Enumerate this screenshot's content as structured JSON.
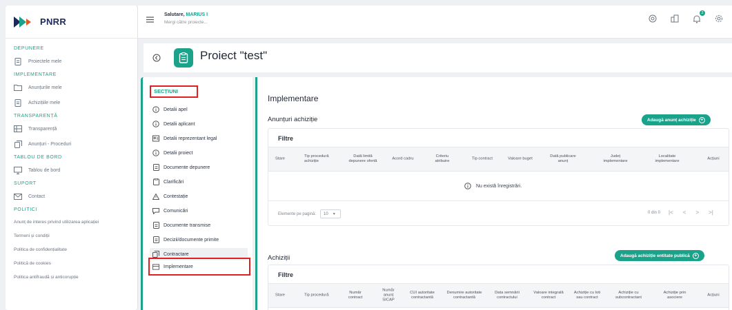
{
  "logo": {
    "text": "PNRR"
  },
  "sidebar": {
    "sections": [
      {
        "title": "DEPUNERE",
        "items": [
          {
            "label": "Proiectele mele",
            "icon": "document-icon"
          }
        ]
      },
      {
        "title": "IMPLEMENTARE",
        "items": [
          {
            "label": "Anunțurile mele",
            "icon": "folder-icon"
          },
          {
            "label": "Achizițiile mele",
            "icon": "document-icon"
          }
        ]
      },
      {
        "title": "TRANSPARENȚĂ",
        "items": [
          {
            "label": "Transparență",
            "icon": "grid-icon"
          },
          {
            "label": "Anunțuri - Proceduri",
            "icon": "copy-icon"
          }
        ]
      },
      {
        "title": "TABLOU DE BORD",
        "items": [
          {
            "label": "Tablou de bord",
            "icon": "monitor-icon"
          }
        ]
      },
      {
        "title": "SUPORT",
        "items": [
          {
            "label": "Contact",
            "icon": "mail-icon"
          }
        ]
      },
      {
        "title": "POLITICI",
        "items": []
      }
    ],
    "policy_links": [
      "Anunț de interes privind utilizarea aplicației",
      "Termeni și condiții",
      "Politica de confidențialitate",
      "Politică de cookies",
      "Politica antifraudă și anticorupție"
    ]
  },
  "header": {
    "greeting": "Salutare,",
    "user_name": "MARIUS I",
    "goto": "Mergi către proiecte...",
    "badge_count": "2"
  },
  "project": {
    "title": "Proiect \"test\""
  },
  "sections_panel": {
    "title": "SECȚIUNI",
    "items": [
      {
        "label": "Detalii apel",
        "icon": "info-icon"
      },
      {
        "label": "Detalii aplicant",
        "icon": "info-icon"
      },
      {
        "label": "Detalii reprezentant legal",
        "icon": "id-card-icon"
      },
      {
        "label": "Detalii proiect",
        "icon": "info-icon"
      },
      {
        "label": "Documente depunere",
        "icon": "document-icon"
      },
      {
        "label": "Clarificări",
        "icon": "clipboard-icon"
      },
      {
        "label": "Contestație",
        "icon": "warning-icon"
      },
      {
        "label": "Comunicări",
        "icon": "chat-icon"
      },
      {
        "label": "Documente transmise",
        "icon": "document-icon"
      },
      {
        "label": "Decizii/documente primite",
        "icon": "document-icon"
      },
      {
        "label": "Contractare",
        "icon": "copy-icon"
      },
      {
        "label": "Implementare",
        "icon": "table-icon"
      }
    ],
    "active_index": 11
  },
  "main": {
    "title": "Implementare",
    "anunturi": {
      "title": "Anunțuri achiziție",
      "add_button": "Adaugă anunț achiziție",
      "filter_label": "Filtre",
      "columns": [
        "Stare",
        "Tip procedură achiziție",
        "Dată limită depunere ofertă",
        "Acord cadru",
        "Criteriu atribuire",
        "Tip contract",
        "Valoare buget",
        "Dată publicare anunț",
        "Județ implementare",
        "Localitate implementare",
        "Acțiuni"
      ],
      "empty_text": "Nu există înregistrări.",
      "per_page_label": "Elemente pe pagină:",
      "per_page_value": "10",
      "range_text": "0 din 0"
    },
    "achizitii": {
      "title": "Achiziții",
      "add_button": "Adaugă achiziție entitate publică",
      "filter_label": "Filtre",
      "columns": [
        "Stare",
        "Tip procedură",
        "Număr contract",
        "Număr anunț SICAP",
        "CUI autoritate contractantă",
        "Denumire autoritate contractantă",
        "Data semnării contractului",
        "Valoare integrală contract",
        "Achiziție cu loti sau contract",
        "Achiziție cu subcontractant",
        "Achiziție prin asociere",
        "Acțiuni"
      ]
    }
  }
}
